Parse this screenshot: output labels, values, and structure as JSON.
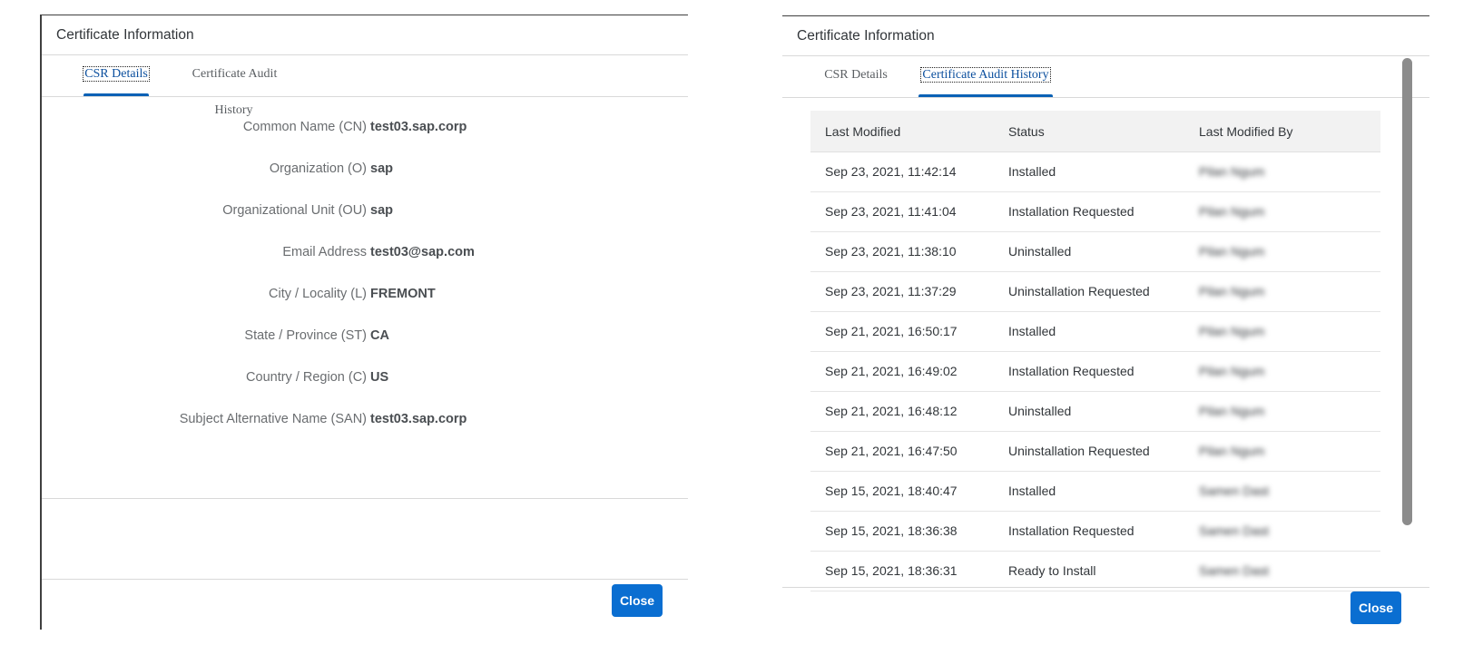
{
  "left_dialog": {
    "title": "Certificate Information",
    "tabs": [
      {
        "label": "CSR Details",
        "active": true
      },
      {
        "label": "Certificate Audit History",
        "active": false
      }
    ],
    "csr_fields": [
      {
        "label": "Common Name (CN)",
        "value": "test03.sap.corp"
      },
      {
        "label": "Organization (O)",
        "value": "sap"
      },
      {
        "label": "Organizational Unit (OU)",
        "value": "sap"
      },
      {
        "label": "Email Address",
        "value": "test03@sap.com"
      },
      {
        "label": "City / Locality (L)",
        "value": "FREMONT"
      },
      {
        "label": "State / Province (ST)",
        "value": "CA"
      },
      {
        "label": "Country / Region (C)",
        "value": "US"
      },
      {
        "label": "Subject Alternative Name (SAN)",
        "value": "test03.sap.corp"
      }
    ],
    "close_label": "Close"
  },
  "right_dialog": {
    "title": "Certificate Information",
    "tabs": [
      {
        "label": "CSR Details",
        "active": false
      },
      {
        "label": "Certificate Audit History",
        "active": true
      }
    ],
    "table": {
      "columns": [
        "Last Modified",
        "Status",
        "Last Modified By"
      ],
      "rows": [
        {
          "last_modified": "Sep 23, 2021, 11:42:14",
          "status": "Installed",
          "modified_by": "Pilan Ngum"
        },
        {
          "last_modified": "Sep 23, 2021, 11:41:04",
          "status": "Installation Requested",
          "modified_by": "Pilan Ngum"
        },
        {
          "last_modified": "Sep 23, 2021, 11:38:10",
          "status": "Uninstalled",
          "modified_by": "Pilan Ngum"
        },
        {
          "last_modified": "Sep 23, 2021, 11:37:29",
          "status": "Uninstallation Requested",
          "modified_by": "Pilan Ngum"
        },
        {
          "last_modified": "Sep 21, 2021, 16:50:17",
          "status": "Installed",
          "modified_by": "Pilan Ngum"
        },
        {
          "last_modified": "Sep 21, 2021, 16:49:02",
          "status": "Installation Requested",
          "modified_by": "Pilan Ngum"
        },
        {
          "last_modified": "Sep 21, 2021, 16:48:12",
          "status": "Uninstalled",
          "modified_by": "Pilan Ngum"
        },
        {
          "last_modified": "Sep 21, 2021, 16:47:50",
          "status": "Uninstallation Requested",
          "modified_by": "Pilan Ngum"
        },
        {
          "last_modified": "Sep 15, 2021, 18:40:47",
          "status": "Installed",
          "modified_by": "Samen Dast"
        },
        {
          "last_modified": "Sep 15, 2021, 18:36:38",
          "status": "Installation Requested",
          "modified_by": "Samen Dast"
        },
        {
          "last_modified": "Sep 15, 2021, 18:36:31",
          "status": "Ready to Install",
          "modified_by": "Samen Dast"
        }
      ]
    },
    "close_label": "Close"
  },
  "colors": {
    "accent": "#0a6ed1",
    "tab_indicator": "#0a61b5",
    "active_tab_text": "#0b4f9e",
    "header_bg": "#f2f2f2"
  }
}
